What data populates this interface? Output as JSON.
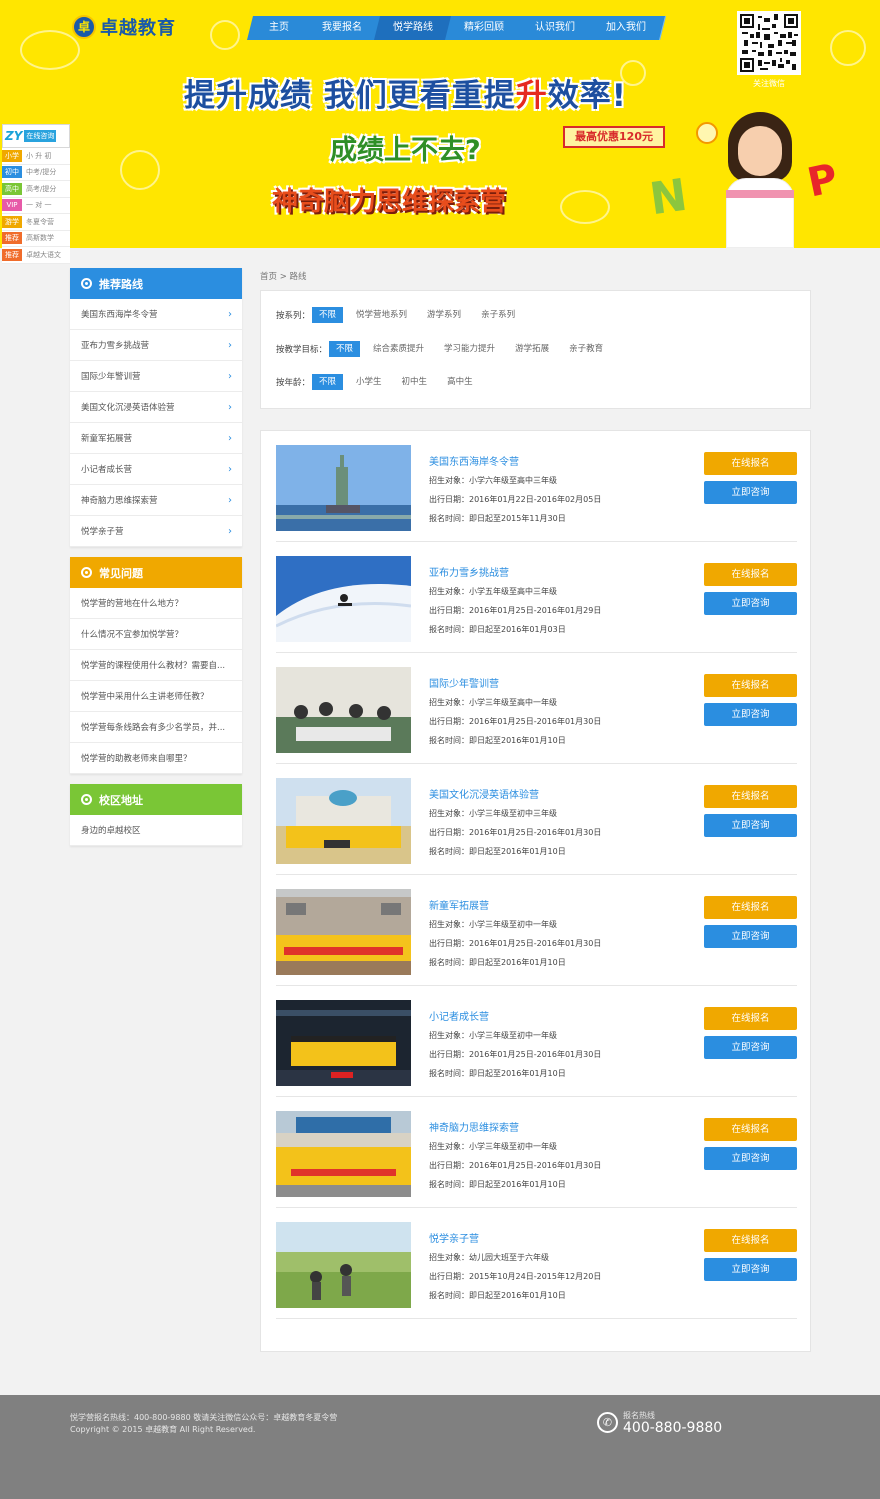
{
  "header": {
    "logo_mark": "卓",
    "logo_text": "卓越教育",
    "nav": [
      {
        "label": "主页"
      },
      {
        "label": "我要报名"
      },
      {
        "label": "悦学路线"
      },
      {
        "label": "精彩回顾"
      },
      {
        "label": "认识我们"
      },
      {
        "label": "加入我们"
      }
    ],
    "qr_label": "关注微信"
  },
  "banner": {
    "slogan_a": "提升成绩",
    "slogan_b": "我们更看重提",
    "slogan_c": "升",
    "slogan_d": "效率!",
    "sub1": "成绩上不去?",
    "promo": "最高优惠120元",
    "sub2": "神奇脑力思维探索营"
  },
  "side_widget": {
    "logo": "ZY",
    "title": "在线咨询",
    "items": [
      {
        "tag": "小学",
        "text": "小 升 初",
        "color": "#f0a800"
      },
      {
        "tag": "初中",
        "text": "中考/提分",
        "color": "#2b8ee0"
      },
      {
        "tag": "高中",
        "text": "高考/提分",
        "color": "#7ac636"
      },
      {
        "tag": "VIP",
        "text": "一 对 一",
        "color": "#e75aa8"
      },
      {
        "tag": "游学",
        "text": "冬夏令营",
        "color": "#f0a800"
      },
      {
        "tag": "推荐",
        "text": "高斯数学",
        "color": "#f06c2b"
      },
      {
        "tag": "推荐",
        "text": "卓越大语文",
        "color": "#f06c2b"
      }
    ]
  },
  "sidebar": {
    "routes_title": "推荐路线",
    "routes": [
      {
        "label": "美国东西海岸冬令营"
      },
      {
        "label": "亚布力雪乡挑战营"
      },
      {
        "label": "国际少年警训营"
      },
      {
        "label": "美国文化沉浸英语体验营"
      },
      {
        "label": "新童军拓展营"
      },
      {
        "label": "小记者成长营"
      },
      {
        "label": "神奇脑力思维探索营"
      },
      {
        "label": "悦学亲子营"
      }
    ],
    "arrow": "›",
    "faq_title": "常见问题",
    "faq": [
      {
        "label": "悦学营的营地在什么地方？"
      },
      {
        "label": "什么情况不宜参加悦学营？"
      },
      {
        "label": "悦学营的课程使用什么教材？需要自..."
      },
      {
        "label": "悦学营中采用什么主讲老师任教？"
      },
      {
        "label": "悦学营每条线路会有多少名学员，并..."
      },
      {
        "label": "悦学营的助教老师来自哪里？"
      }
    ],
    "campus_title": "校区地址",
    "campus": [
      {
        "label": "身边的卓越校区"
      }
    ]
  },
  "breadcrumb": "首页 > 路线",
  "filters": [
    {
      "label": "按系列：",
      "options": [
        "不限",
        "悦学营地系列",
        "游学系列",
        "亲子系列"
      ]
    },
    {
      "label": "按教学目标：",
      "options": [
        "不限",
        "综合素质提升",
        "学习能力提升",
        "游学拓展",
        "亲子教育"
      ]
    },
    {
      "label": "按年龄：",
      "options": [
        "不限",
        "小学生",
        "初中生",
        "高中生"
      ]
    }
  ],
  "items": [
    {
      "title": "美国东西海岸冬令营",
      "target": "招生对象：小学六年级至高中三年级",
      "dates": "出行日期：2016年01月22日-2016年02月05日",
      "deadline": "报名时间：即日起至2015年11月30日"
    },
    {
      "title": "亚布力雪乡挑战营",
      "target": "招生对象：小学五年级至高中三年级",
      "dates": "出行日期：2016年01月25日-2016年01月29日",
      "deadline": "报名时间：即日起至2016年01月03日"
    },
    {
      "title": "国际少年警训营",
      "target": "招生对象：小学三年级至高中一年级",
      "dates": "出行日期：2016年01月25日-2016年01月30日",
      "deadline": "报名时间：即日起至2016年01月10日"
    },
    {
      "title": "美国文化沉浸英语体验营",
      "target": "招生对象：小学三年级至初中三年级",
      "dates": "出行日期：2016年01月25日-2016年01月30日",
      "deadline": "报名时间：即日起至2016年01月10日"
    },
    {
      "title": "新童军拓展营",
      "target": "招生对象：小学三年级至初中一年级",
      "dates": "出行日期：2016年01月25日-2016年01月30日",
      "deadline": "报名时间：即日起至2016年01月10日"
    },
    {
      "title": "小记者成长营",
      "target": "招生对象：小学三年级至初中一年级",
      "dates": "出行日期：2016年01月25日-2016年01月30日",
      "deadline": "报名时间：即日起至2016年01月10日"
    },
    {
      "title": "神奇脑力思维探索营",
      "target": "招生对象：小学三年级至初中一年级",
      "dates": "出行日期：2016年01月25日-2016年01月30日",
      "deadline": "报名时间：即日起至2016年01月10日"
    },
    {
      "title": "悦学亲子营",
      "target": "招生对象：幼儿园大班至于六年级",
      "dates": "出行日期：2015年10月24日-2015年12月20日",
      "deadline": "报名时间：即日起至2016年01月10日"
    }
  ],
  "item_buttons": {
    "signup": "在线报名",
    "consult": "立即咨询"
  },
  "footer": {
    "line1": "悦学营报名热线：400-800-9880 敬请关注微信公众号：卓越教育冬夏令营",
    "line2": "Copyright © 2015 卓越教育 All Right Reserved.",
    "hotline_label": "报名热线",
    "hotline_number": "400-880-9880",
    "phone_icon": "✆"
  }
}
